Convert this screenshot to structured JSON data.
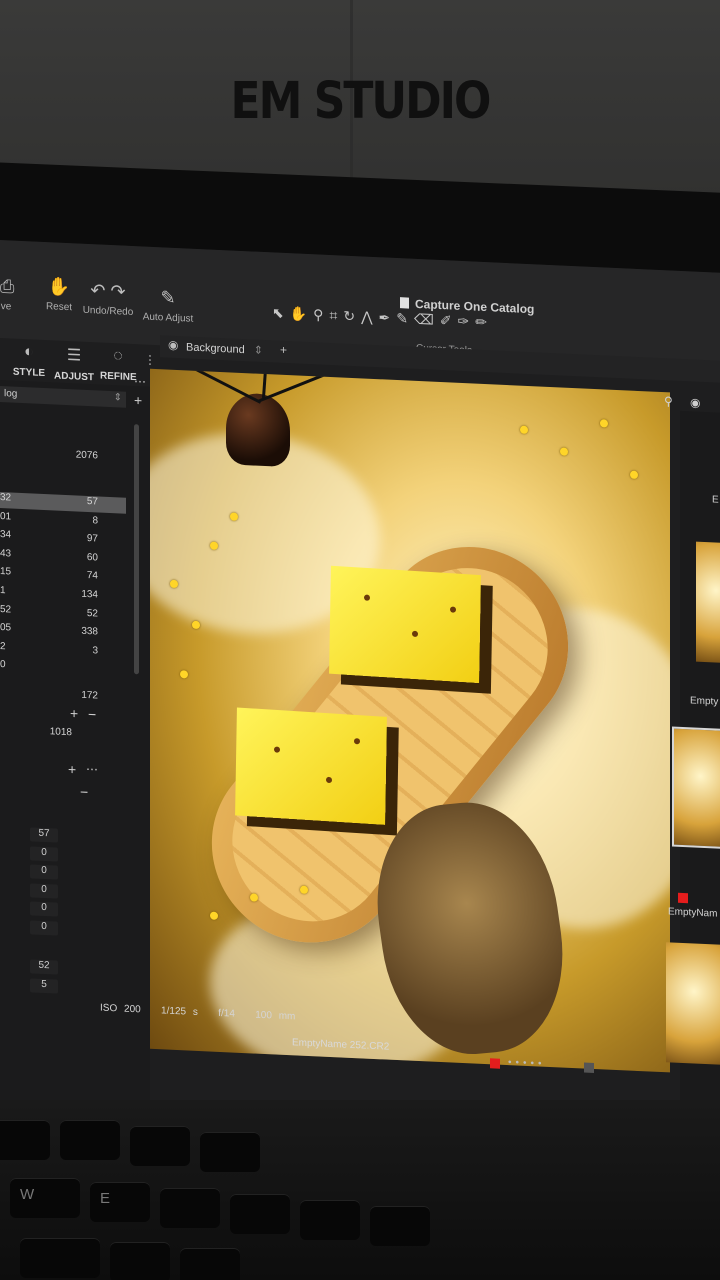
{
  "overlay": {
    "title": "EM STUDIO"
  },
  "toolbar": {
    "left_partial": "ve",
    "reset": "Reset",
    "undo_redo": "Undo/Redo",
    "auto_adjust": "Auto Adjust",
    "catalog_title": "Capture One Catalog",
    "cursor_tools_label": "Cursor Tools"
  },
  "tabs": {
    "style": "STYLE",
    "adjust": "ADJUST",
    "refine": "REFINE"
  },
  "layer": {
    "name": "Background"
  },
  "left_panel": {
    "header": "log",
    "top_value": "2076",
    "rows": [
      {
        "k": "32",
        "v": "57",
        "selected": true
      },
      {
        "k": "01",
        "v": "8"
      },
      {
        "k": "34",
        "v": "97"
      },
      {
        "k": "43",
        "v": "60"
      },
      {
        "k": "15",
        "v": "74"
      },
      {
        "k": "1",
        "v": "134"
      },
      {
        "k": "52",
        "v": "52"
      },
      {
        "k": "05",
        "v": "338"
      },
      {
        "k": "2",
        "v": "3"
      },
      {
        "k": "0",
        "v": ""
      }
    ],
    "total_a": "172",
    "total_b": "1018",
    "values2": [
      "57",
      "0",
      "0",
      "0",
      "0",
      "0"
    ],
    "values3": [
      "52",
      "5"
    ]
  },
  "photo": {
    "iso": "ISO 200",
    "shutter": "1/125 s",
    "aperture": "f/14",
    "focal": "100 mm",
    "filename": "EmptyName 252.CR2"
  },
  "filmstrip": {
    "label_a": "Empty",
    "label_b": "EmptyNam",
    "partial_top": "E"
  },
  "keyboard": {
    "keys": [
      "W",
      "E"
    ]
  },
  "colors": {
    "accent": "#e0562b",
    "flag": "#e51d1d"
  }
}
